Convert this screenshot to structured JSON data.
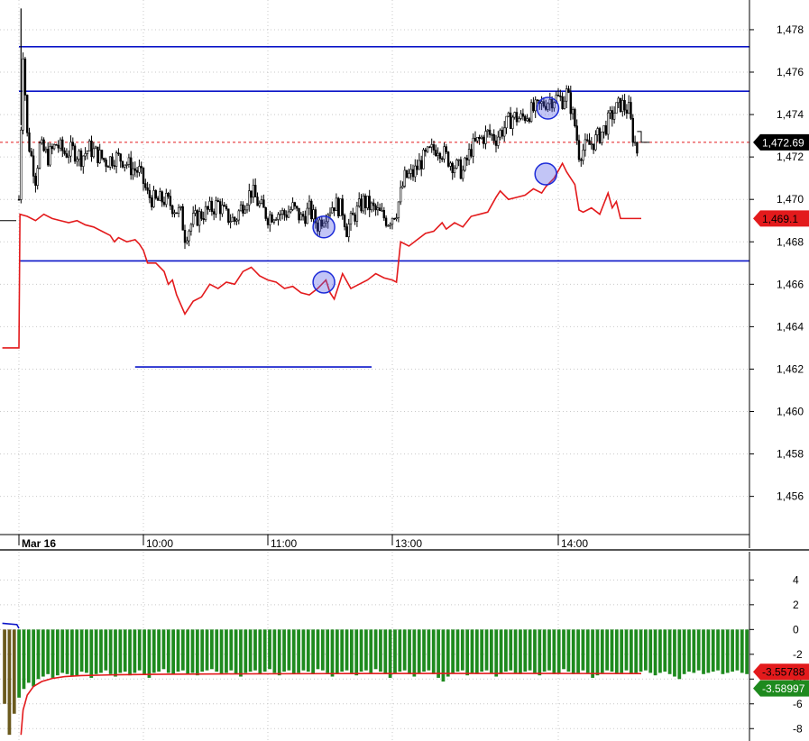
{
  "chart_data": [
    {
      "type": "line",
      "panel": "price",
      "title": "",
      "xlabel": "",
      "ylabel": "",
      "x_tick_labels": [
        "Mar 16",
        "10:00",
        "11:00",
        "13:00",
        "14:00"
      ],
      "x_tick_times": [
        0,
        60,
        120,
        180,
        260
      ],
      "ylim": [
        1454.2,
        1479.4
      ],
      "y_ticks": [
        1456,
        1458,
        1460,
        1462,
        1464,
        1466,
        1468,
        1470,
        1472,
        1474,
        1476,
        1478
      ],
      "y_tick_labels": [
        "1,456",
        "1,458",
        "1,460",
        "1,462",
        "1,464",
        "1,466",
        "1,468",
        "1,470",
        "1,472",
        "1,474",
        "1,476",
        "1,478"
      ],
      "grid": true,
      "candles_close": [
        [
          0,
          1470
        ],
        [
          2,
          1477
        ],
        [
          4,
          1473
        ],
        [
          6,
          1472
        ],
        [
          8,
          1471
        ],
        [
          10,
          1472.5
        ],
        [
          14,
          1472
        ],
        [
          18,
          1472.6
        ],
        [
          22,
          1472.2
        ],
        [
          26,
          1472.3
        ],
        [
          30,
          1472
        ],
        [
          34,
          1472.4
        ],
        [
          38,
          1472.1
        ],
        [
          42,
          1471.8
        ],
        [
          46,
          1472
        ],
        [
          50,
          1471.9
        ],
        [
          54,
          1471.5
        ],
        [
          58,
          1471.3
        ],
        [
          60,
          1470.8
        ],
        [
          62,
          1470.2
        ],
        [
          66,
          1469.9
        ],
        [
          70,
          1470
        ],
        [
          74,
          1469.7
        ],
        [
          78,
          1469.3
        ],
        [
          80,
          1468.3
        ],
        [
          84,
          1469
        ],
        [
          88,
          1469.3
        ],
        [
          92,
          1469.5
        ],
        [
          96,
          1469.8
        ],
        [
          100,
          1469.2
        ],
        [
          104,
          1469
        ],
        [
          108,
          1469.8
        ],
        [
          112,
          1470.4
        ],
        [
          116,
          1469.7
        ],
        [
          120,
          1469.2
        ],
        [
          124,
          1469.4
        ],
        [
          128,
          1469.3
        ],
        [
          132,
          1469.6
        ],
        [
          136,
          1469.1
        ],
        [
          140,
          1469.5
        ],
        [
          144,
          1468.8
        ],
        [
          148,
          1469.4
        ],
        [
          152,
          1469.8
        ],
        [
          156,
          1469.5
        ],
        [
          158,
          1468.6
        ],
        [
          162,
          1469.3
        ],
        [
          166,
          1469.9
        ],
        [
          170,
          1469.6
        ],
        [
          174,
          1469.3
        ],
        [
          178,
          1469
        ],
        [
          182,
          1469.5
        ],
        [
          186,
          1471
        ],
        [
          190,
          1471.2
        ],
        [
          194,
          1471.8
        ],
        [
          198,
          1472.2
        ],
        [
          202,
          1472.5
        ],
        [
          206,
          1472
        ],
        [
          210,
          1471.6
        ],
        [
          214,
          1471.3
        ],
        [
          218,
          1472.4
        ],
        [
          222,
          1472.8
        ],
        [
          226,
          1473.1
        ],
        [
          230,
          1472.9
        ],
        [
          234,
          1473.4
        ],
        [
          238,
          1473.9
        ],
        [
          242,
          1473.8
        ],
        [
          246,
          1474.1
        ],
        [
          250,
          1474.3
        ],
        [
          254,
          1474.6
        ],
        [
          258,
          1474.8
        ],
        [
          262,
          1474.7
        ],
        [
          264,
          1475
        ],
        [
          266,
          1474.4
        ],
        [
          268,
          1473.5
        ],
        [
          270,
          1472.2
        ],
        [
          274,
          1472.5
        ],
        [
          278,
          1472.8
        ],
        [
          282,
          1473.3
        ],
        [
          286,
          1474
        ],
        [
          290,
          1474.5
        ],
        [
          294,
          1474.2
        ],
        [
          296,
          1473
        ],
        [
          298,
          1472.3
        ]
      ],
      "last_price": 1472.69,
      "last_price_label": "1,472.69",
      "series": [
        {
          "name": "",
          "color": "#e31a1c",
          "points": [
            [
              -8,
              1463
            ],
            [
              0,
              1463
            ],
            [
              0.5,
              1469.3
            ],
            [
              4,
              1469.2
            ],
            [
              8,
              1469
            ],
            [
              12,
              1469.3
            ],
            [
              16,
              1469.1
            ],
            [
              20,
              1469
            ],
            [
              24,
              1468.9
            ],
            [
              28,
              1469
            ],
            [
              32,
              1468.8
            ],
            [
              36,
              1468.7
            ],
            [
              40,
              1468.5
            ],
            [
              44,
              1468.3
            ],
            [
              46,
              1468
            ],
            [
              48,
              1468.2
            ],
            [
              52,
              1468
            ],
            [
              56,
              1468.1
            ],
            [
              58,
              1467.9
            ],
            [
              60,
              1467.6
            ],
            [
              62,
              1467
            ],
            [
              66,
              1467
            ],
            [
              70,
              1466.6
            ],
            [
              72,
              1466
            ],
            [
              74,
              1466.2
            ],
            [
              76,
              1465.5
            ],
            [
              80,
              1464.6
            ],
            [
              84,
              1465.2
            ],
            [
              88,
              1465.4
            ],
            [
              92,
              1466
            ],
            [
              96,
              1465.8
            ],
            [
              100,
              1466.1
            ],
            [
              104,
              1466
            ],
            [
              108,
              1466.6
            ],
            [
              112,
              1466.8
            ],
            [
              116,
              1466.4
            ],
            [
              120,
              1466.2
            ],
            [
              124,
              1466.1
            ],
            [
              128,
              1465.8
            ],
            [
              132,
              1465.9
            ],
            [
              136,
              1465.6
            ],
            [
              140,
              1465.5
            ],
            [
              144,
              1465.8
            ],
            [
              148,
              1466.2
            ],
            [
              150,
              1465.6
            ],
            [
              152,
              1465.3
            ],
            [
              156,
              1466.5
            ],
            [
              160,
              1465.8
            ],
            [
              164,
              1466
            ],
            [
              168,
              1466.2
            ],
            [
              172,
              1466.5
            ],
            [
              176,
              1466.3
            ],
            [
              180,
              1466.2
            ],
            [
              182,
              1466.1
            ],
            [
              184,
              1468
            ],
            [
              188,
              1467.8
            ],
            [
              192,
              1468.1
            ],
            [
              196,
              1468.4
            ],
            [
              200,
              1468.5
            ],
            [
              204,
              1468.9
            ],
            [
              206,
              1468.6
            ],
            [
              210,
              1468.9
            ],
            [
              214,
              1468.7
            ],
            [
              218,
              1469.2
            ],
            [
              222,
              1469.3
            ],
            [
              226,
              1469.4
            ],
            [
              230,
              1470.1
            ],
            [
              232,
              1470.4
            ],
            [
              236,
              1470
            ],
            [
              240,
              1470.1
            ],
            [
              244,
              1470.2
            ],
            [
              248,
              1470.5
            ],
            [
              252,
              1470.3
            ],
            [
              254,
              1470.6
            ],
            [
              258,
              1471
            ],
            [
              262,
              1471.7
            ],
            [
              264,
              1471.3
            ],
            [
              268,
              1470.7
            ],
            [
              270,
              1469.5
            ],
            [
              272,
              1469.4
            ],
            [
              276,
              1469.6
            ],
            [
              280,
              1469.3
            ],
            [
              284,
              1470.3
            ],
            [
              286,
              1469.6
            ],
            [
              288,
              1469.9
            ],
            [
              290,
              1469.1
            ],
            [
              296,
              1469.1
            ],
            [
              300,
              1469.1
            ]
          ]
        }
      ],
      "horizontal_levels": [
        {
          "y": 1477.2,
          "x_from": 0,
          "x_to": 300,
          "color": "#0a14c8"
        },
        {
          "y": 1475.1,
          "x_from": 0,
          "x_to": 300,
          "color": "#0a14c8"
        },
        {
          "y": 1467.1,
          "x_from": 0,
          "x_to": 300,
          "color": "#0a14c8"
        },
        {
          "y": 1462.1,
          "x_from": 56,
          "x_to": 170,
          "color": "#0a14c8"
        }
      ],
      "last_line_value_label": "1,469.1",
      "markers": [
        [
          147,
          1468.7
        ],
        [
          147,
          1466.1
        ],
        [
          255,
          1474.3
        ],
        [
          254,
          1471.2
        ]
      ]
    },
    {
      "type": "bar",
      "panel": "indicator",
      "title": "",
      "xlabel": "",
      "ylabel": "",
      "ylim": [
        -9.0,
        5.7
      ],
      "y_ticks": [
        -8,
        -6,
        -4,
        -2,
        0,
        2,
        4
      ],
      "y_tick_labels": [
        "-8",
        "-6",
        "-4",
        "-2",
        "0",
        "2",
        "4"
      ],
      "grid": true,
      "bar_color": "#1e8a1e",
      "bar_values": [
        -6.0,
        -8.5,
        -6.8,
        -5.5,
        -4.8,
        -4.3,
        -4.6,
        -4.0,
        -3.8,
        -3.6,
        -3.9,
        -3.7,
        -3.5,
        -3.6,
        -3.8,
        -3.7,
        -3.4,
        -3.5,
        -3.9,
        -3.6,
        -3.5,
        -3.3,
        -3.6,
        -3.8,
        -3.5,
        -3.4,
        -3.7,
        -3.5,
        -3.3,
        -3.6,
        -3.9,
        -3.5,
        -3.4,
        -3.2,
        -3.5,
        -3.6,
        -3.4,
        -3.3,
        -3.6,
        -3.5,
        -3.7,
        -3.4,
        -3.3,
        -3.2,
        -3.4,
        -3.6,
        -3.5,
        -3.3,
        -3.6,
        -3.8,
        -3.5,
        -3.4,
        -3.3,
        -3.6,
        -3.4,
        -3.2,
        -3.5,
        -3.7,
        -3.4,
        -3.3,
        -3.6,
        -3.5,
        -3.3,
        -3.4,
        -3.6,
        -3.2,
        -3.3,
        -3.5,
        -3.8,
        -3.6,
        -3.4,
        -3.3,
        -3.5,
        -3.7,
        -3.4,
        -3.3,
        -3.5,
        -3.2,
        -3.4,
        -3.6,
        -3.9,
        -3.5,
        -3.4,
        -3.3,
        -3.6,
        -3.8,
        -3.5,
        -3.4,
        -3.3,
        -3.6,
        -3.9,
        -4.2,
        -3.8,
        -3.5,
        -3.4,
        -3.3,
        -3.7,
        -3.5,
        -3.6,
        -3.4,
        -3.3,
        -3.5,
        -3.8,
        -3.6,
        -3.4,
        -3.3,
        -3.5,
        -3.6,
        -3.4,
        -3.3,
        -3.5,
        -3.7,
        -3.4,
        -3.3,
        -3.6,
        -3.5,
        -3.2,
        -3.4,
        -3.6,
        -3.5,
        -3.3,
        -3.5,
        -3.9,
        -3.7,
        -3.5,
        -3.3,
        -3.4,
        -3.6,
        -3.5,
        -3.3,
        -3.6,
        -3.5,
        -3.4,
        -3.3,
        -3.5,
        -3.7,
        -3.5,
        -3.4,
        -3.6,
        -3.8,
        -4.0,
        -3.6,
        -3.4,
        -3.5,
        -3.3,
        -3.6,
        -3.5,
        -3.4,
        -3.3,
        -3.6,
        -3.5,
        -3.4,
        -3.3,
        -3.5,
        -3.6
      ],
      "last_bar_value_label": "-3.58997",
      "series": [
        {
          "name": "",
          "color": "#e31a1c",
          "points": [
            [
              1,
              -8.5
            ],
            [
              2,
              -6.5
            ],
            [
              4,
              -5.3
            ],
            [
              7,
              -4.6
            ],
            [
              11,
              -4.2
            ],
            [
              16,
              -3.95
            ],
            [
              22,
              -3.8
            ],
            [
              30,
              -3.72
            ],
            [
              45,
              -3.66
            ],
            [
              70,
              -3.61
            ],
            [
              100,
              -3.58
            ],
            [
              150,
              -3.56
            ],
            [
              200,
              -3.55
            ],
            [
              260,
              -3.55
            ],
            [
              300,
              -3.5578
            ]
          ]
        },
        {
          "name": "",
          "color": "#0a14c8",
          "points": [
            [
              -8,
              0.5
            ],
            [
              -1,
              0.4
            ],
            [
              0,
              0.1
            ]
          ]
        }
      ],
      "last_line_value_label": "-3.55788"
    }
  ]
}
